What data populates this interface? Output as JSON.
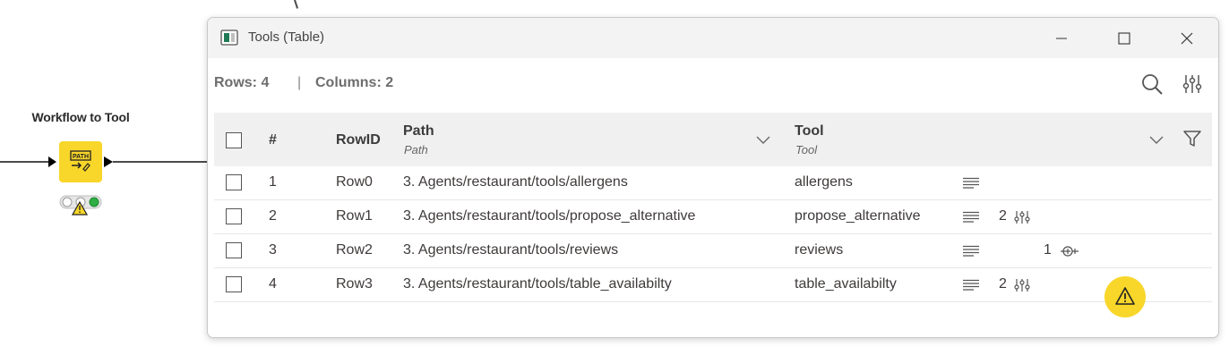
{
  "canvas": {
    "node": {
      "label": "Workflow to Tool",
      "icon": "path-to-tool-icon",
      "icon_text": "PATH",
      "color": "#f8d62a",
      "status": "warning"
    }
  },
  "dialog": {
    "title": "Tools (Table)",
    "app_icon": "table-view-icon",
    "controls": [
      "minimize-icon",
      "maximize-icon",
      "close-icon"
    ],
    "stats": {
      "rows": "Rows: 4",
      "separator": "|",
      "columns": "Columns: 2"
    },
    "toolbar": [
      "search-icon",
      "settings-sliders-icon"
    ],
    "table": {
      "headers": {
        "index": "#",
        "rowid": "RowID",
        "path": "Path",
        "path_type": "Path",
        "tool": "Tool",
        "tool_type": "Tool"
      },
      "rows": [
        {
          "index": "1",
          "rowid": "Row0",
          "path": "3. Agents/restaurant/tools/allergens",
          "tool": "allergens",
          "params_count": "",
          "ports_count": ""
        },
        {
          "index": "2",
          "rowid": "Row1",
          "path": "3. Agents/restaurant/tools/propose_alternative",
          "tool": "propose_alternative",
          "params_count": "2",
          "ports_count": ""
        },
        {
          "index": "3",
          "rowid": "Row2",
          "path": "3. Agents/restaurant/tools/reviews",
          "tool": "reviews",
          "params_count": "",
          "ports_count": "1"
        },
        {
          "index": "4",
          "rowid": "Row3",
          "path": "3. Agents/restaurant/tools/table_availabilty",
          "tool": "table_availabilty",
          "params_count": "2",
          "ports_count": ""
        }
      ]
    },
    "warning_badge": "warning-icon",
    "accent": "#f8d62a"
  }
}
